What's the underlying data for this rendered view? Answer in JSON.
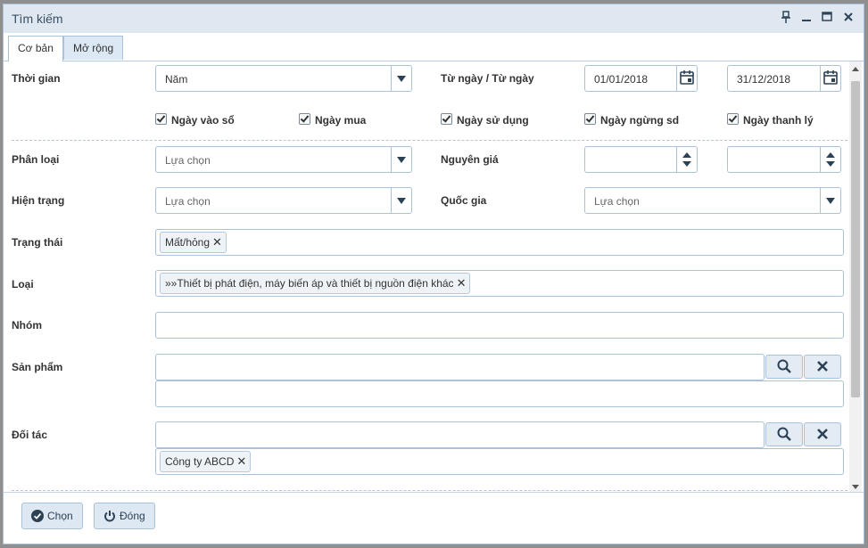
{
  "window": {
    "title": "Tìm kiếm"
  },
  "tabs": [
    {
      "label": "Cơ bản"
    },
    {
      "label": "Mở rộng"
    }
  ],
  "thoigian": {
    "label": "Thời gian",
    "value": "Năm"
  },
  "tungay": {
    "label": "Từ ngày / Từ ngày",
    "from": "01/01/2018",
    "to": "31/12/2018"
  },
  "checks": [
    "Ngày vào sổ",
    "Ngày mua",
    "Ngày sử dụng",
    "Ngày ngừng sd",
    "Ngày thanh lý"
  ],
  "phanloai": {
    "label": "Phân loại",
    "placeholder": "Lựa chọn"
  },
  "nguyengia": {
    "label": "Nguyên giá"
  },
  "hientrang": {
    "label": "Hiện trạng",
    "placeholder": "Lựa chọn"
  },
  "quocgia": {
    "label": "Quốc gia",
    "placeholder": "Lựa chọn"
  },
  "trangthai": {
    "label": "Trạng thái",
    "tag": "Mất/hỏng"
  },
  "loai": {
    "label": "Loại",
    "tag": "»»Thiết bị phát điện, máy biến áp và thiết bị nguồn điện khác"
  },
  "nhom": {
    "label": "Nhóm"
  },
  "sanpham": {
    "label": "Sản phẩm"
  },
  "doitac": {
    "label": "Đối tác",
    "tag": "Công ty ABCD"
  },
  "footer": {
    "chon": "Chọn",
    "dong": "Đóng"
  }
}
